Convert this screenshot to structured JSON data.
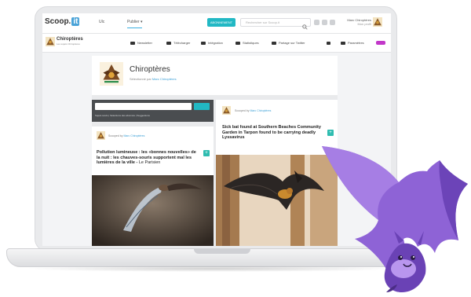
{
  "topbar": {
    "logo_text": "Scoop.",
    "logo_badge": "it",
    "nav": [
      {
        "label": "Ulc"
      },
      {
        "label": "Publier ▾"
      }
    ],
    "teal_button": "ABONNEMENT",
    "search_placeholder": "Rechercher sur Scoop.it",
    "user_name": "Marc Chiroptères",
    "user_sub": "Mon profil"
  },
  "subbar": {
    "title": "Chiroptères",
    "subtitle": "Les sujets Chiroptères",
    "tabs": [
      {
        "label": "Newsletter"
      },
      {
        "label": "Télécharger"
      },
      {
        "label": "Intégration"
      },
      {
        "label": "Statistiques"
      },
      {
        "label": "Partage sur Twitter"
      },
      {
        "label": "Paramètres"
      }
    ]
  },
  "topic": {
    "title": "Chiroptères",
    "by_prefix": "Sélectionné par",
    "by_name": "Marc Chiroptères"
  },
  "search_panel": {
    "links": "Sujets suivis  |  Sélections des abonnés  |  Suggestions"
  },
  "posts": [
    {
      "curated_prefix": "Scooped by",
      "curator": "Marc Chiroptères",
      "title": "Pollution lumineuse : les «bonnes nouvelles» de la nuit : les chauves-souris supportent mal les lumières de la ville -",
      "source": "Le Parisien"
    },
    {
      "curated_prefix": "Scooped by",
      "curator": "Marc Chiroptères",
      "title": "Sick bat found at Southern Beaches Community Garden in Tarpon found to be carrying deadly Lyssavirus",
      "source": ""
    }
  ],
  "colors": {
    "accent_teal": "#22b8c4",
    "link_blue": "#3a9fd6",
    "dark_panel": "#4a4d50",
    "bat_purple": "#7b52c7"
  }
}
